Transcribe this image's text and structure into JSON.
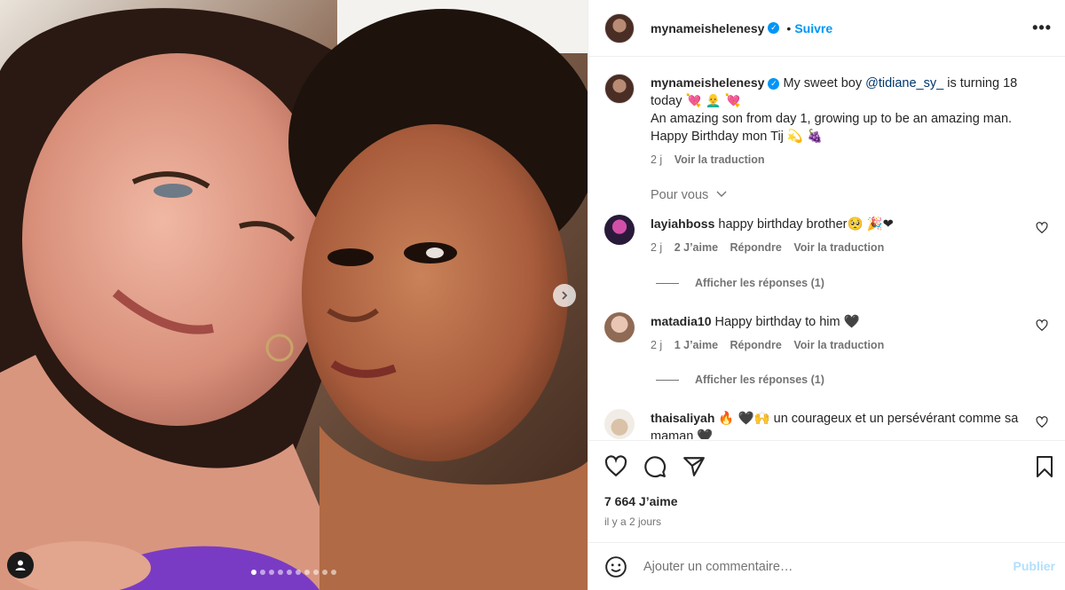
{
  "post": {
    "username": "mynameishelenesy",
    "follow_label": "Suivre",
    "separator": "•",
    "more_icon": "more-horizontal-icon",
    "caption": {
      "prefix": "My sweet boy ",
      "mention": "@tidiane_sy_",
      "line1_suffix": " is turning 18 today 💘 👨‍🦲 💘",
      "line2": "An amazing son from day 1, growing up to be an amazing man.",
      "line3": "Happy Birthday mon Tij 💫 🍇"
    },
    "caption_meta": {
      "age": "2 j",
      "translate": "Voir la traduction"
    },
    "for_you": "Pour vous",
    "likes": "7 664 J’aime",
    "date": "il y a 2 jours",
    "carousel": {
      "slides": 10,
      "active_slide": 1
    }
  },
  "comments": [
    {
      "username": "layiahboss",
      "text": "happy birthday brother🥺 🎉❤",
      "age": "2 j",
      "likes": "2 J’aime",
      "reply": "Répondre",
      "translate": "Voir la traduction",
      "replies_label": "Afficher les réponses (1)"
    },
    {
      "username": "matadia10",
      "text": "Happy birthday to him 🖤",
      "age": "2 j",
      "likes": "1 J’aime",
      "reply": "Répondre",
      "translate": "Voir la traduction",
      "replies_label": "Afficher les réponses (1)"
    },
    {
      "username": "thaisaliyah",
      "text": "🔥 🖤🙌 un courageux et un persévérant comme sa maman 🖤"
    }
  ],
  "add_comment": {
    "placeholder": "Ajouter un commentaire…",
    "publish_label": "Publier"
  },
  "colors": {
    "accent": "#0095f6",
    "mention": "#00376b",
    "muted": "#737373",
    "publish_disabled": "#b2dffc"
  }
}
